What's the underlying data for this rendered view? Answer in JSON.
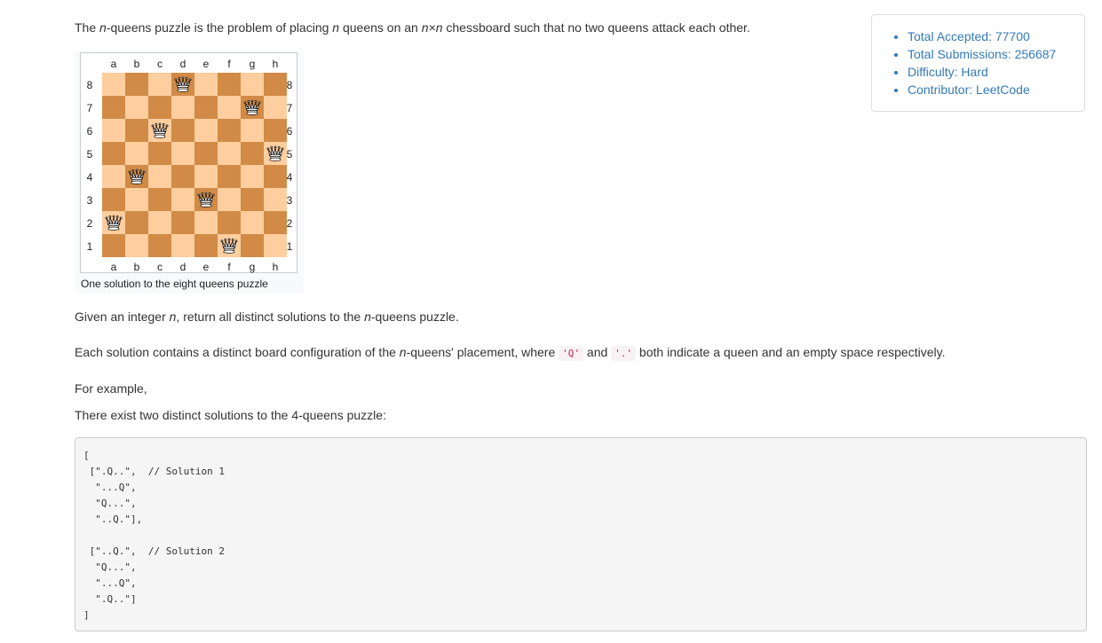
{
  "intro": {
    "p1": "The ",
    "n_italic": "n",
    "p2": "-queens puzzle is the problem of placing ",
    "p3": " queens on an ",
    "nxn": "n×n",
    "p4": " chessboard such that no two queens attack each other."
  },
  "stats": {
    "items": [
      "Total Accepted: 77700",
      "Total Submissions: 256687",
      "Difficulty: Hard",
      "Contributor: LeetCode"
    ]
  },
  "figure": {
    "files": [
      "a",
      "b",
      "c",
      "d",
      "e",
      "f",
      "g",
      "h"
    ],
    "ranks": [
      "8",
      "7",
      "6",
      "5",
      "4",
      "3",
      "2",
      "1"
    ],
    "queens": [
      "d8",
      "g7",
      "c6",
      "h5",
      "b4",
      "e3",
      "a2",
      "f1"
    ],
    "queen_icon": "white-queen-icon",
    "caption": "One solution to the eight queens puzzle",
    "colors": {
      "light": "#ffce9e",
      "dark": "#d18b47"
    }
  },
  "para_given": {
    "a": "Given an integer ",
    "b": ", return all distinct solutions to the ",
    "c": "-queens puzzle."
  },
  "para_each": {
    "a": "Each solution contains a distinct board configuration of the ",
    "b": "-queens' placement, where ",
    "q": "'Q'",
    "and": " and ",
    "dot": "'.'",
    "c": " both indicate a queen and an empty space respectively."
  },
  "for_example": "For example,",
  "two_solutions": "There exist two distinct solutions to the 4-queens puzzle:",
  "code_example": "[\n [\".Q..\",  // Solution 1\n  \"...Q\",\n  \"Q...\",\n  \"..Q.\"],\n\n [\"..Q.\",  // Solution 2\n  \"Q...\",\n  \"...Q\",\n  \".Q..\"]\n]"
}
